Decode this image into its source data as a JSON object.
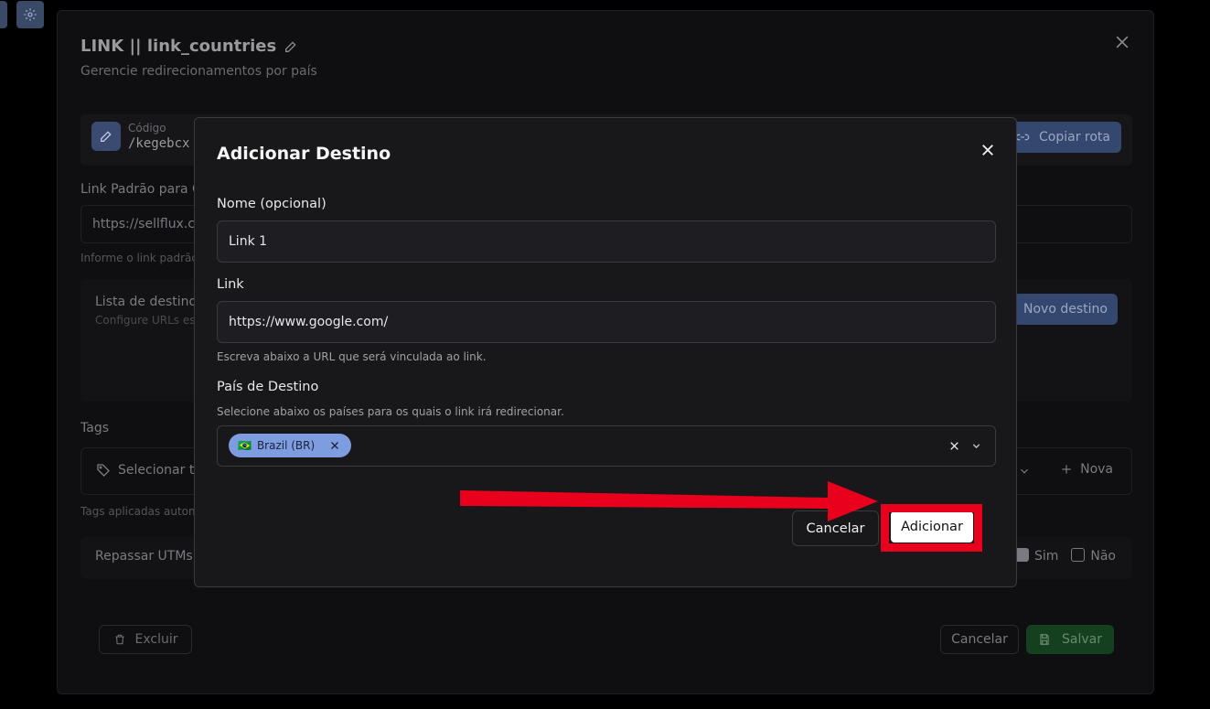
{
  "background": {
    "title": "LINK || link_countries",
    "subtitle": "Gerencie redirecionamentos por país",
    "code_label": "Código",
    "code_value": "/kegebcx",
    "copy_button": "Copiar rota",
    "default_link_label": "Link Padrão para O",
    "default_link_value": "https://sellflux.co",
    "default_link_hint": "Informe o link padrão",
    "destinations_title": "Lista de destino",
    "destinations_subtitle": "Configure URLs esp",
    "new_destination_button": "Novo destino",
    "tags_label": "Tags",
    "tags_placeholder": "Selecionar t",
    "tags_new_button": "Nova",
    "tags_hint": "Tags aplicadas autom",
    "utm_label": "Repassar UTMs p",
    "utm_yes": "Sim",
    "utm_no": "Não",
    "delete_button": "Excluir",
    "cancel_button": "Cancelar",
    "save_button": "Salvar"
  },
  "modal": {
    "title": "Adicionar Destino",
    "name_label": "Nome (opcional)",
    "name_value": "Link 1",
    "link_label": "Link",
    "link_value": "https://www.google.com/",
    "link_hint": "Escreva abaixo a URL que será vinculada ao link.",
    "country_label": "País de Destino",
    "country_hint": "Selecione abaixo os países para os quais o link irá redirecionar.",
    "selected_country": "Brazil (BR)",
    "selected_country_flag": "🇧🇷",
    "cancel_button": "Cancelar",
    "add_button": "Adicionar"
  },
  "colors": {
    "annotation_red": "#e8001c",
    "chip_blue": "#7e9ce0"
  }
}
